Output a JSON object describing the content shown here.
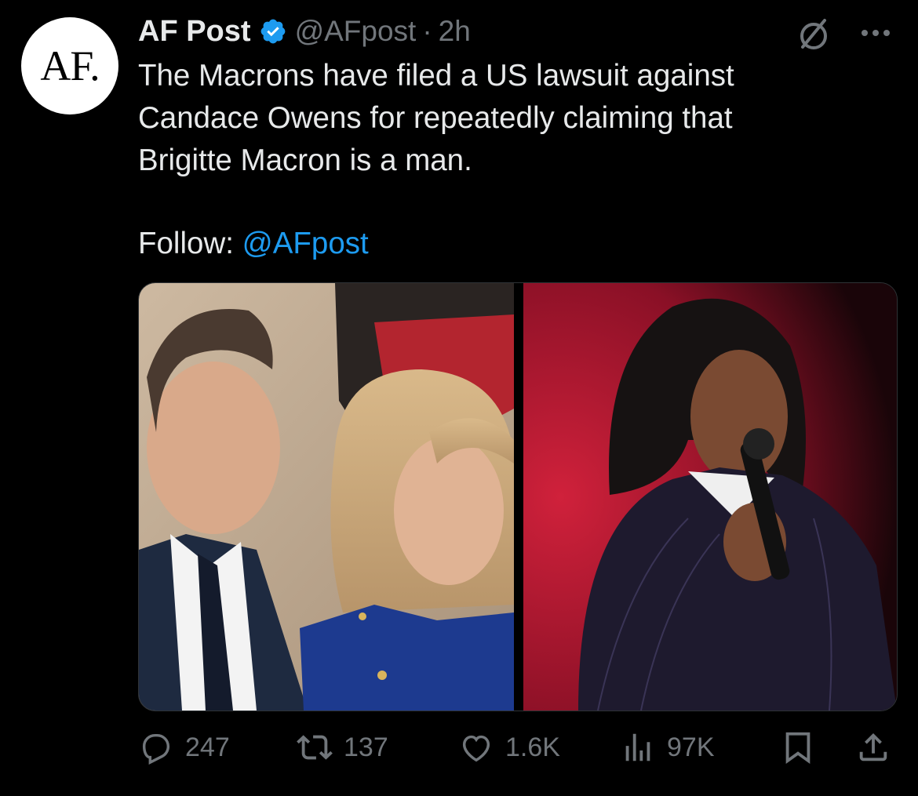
{
  "avatar": {
    "text": "AF."
  },
  "author": {
    "name": "AF Post",
    "handle": "@AFpost",
    "separator": "·",
    "time": "2h"
  },
  "tweet": {
    "lines": [
      "The Macrons have filed a US lawsuit against",
      "Candace Owens for repeatedly claiming that",
      "Brigitte Macron is a man."
    ],
    "follow_label": "Follow: ",
    "follow_link": "@AFpost"
  },
  "actions": {
    "replies": "247",
    "reposts": "137",
    "likes": "1.6K",
    "views": "97K"
  },
  "icons": {
    "verified": "verified-badge-icon",
    "grok": "grok-icon",
    "more": "more-icon",
    "reply": "reply-icon",
    "repost": "repost-icon",
    "like": "like-icon",
    "views": "views-icon",
    "bookmark": "bookmark-icon",
    "share": "share-icon"
  },
  "colors": {
    "background": "#000000",
    "accent": "#1d9bf0",
    "muted": "#71767b",
    "text": "#e7e9ea"
  }
}
